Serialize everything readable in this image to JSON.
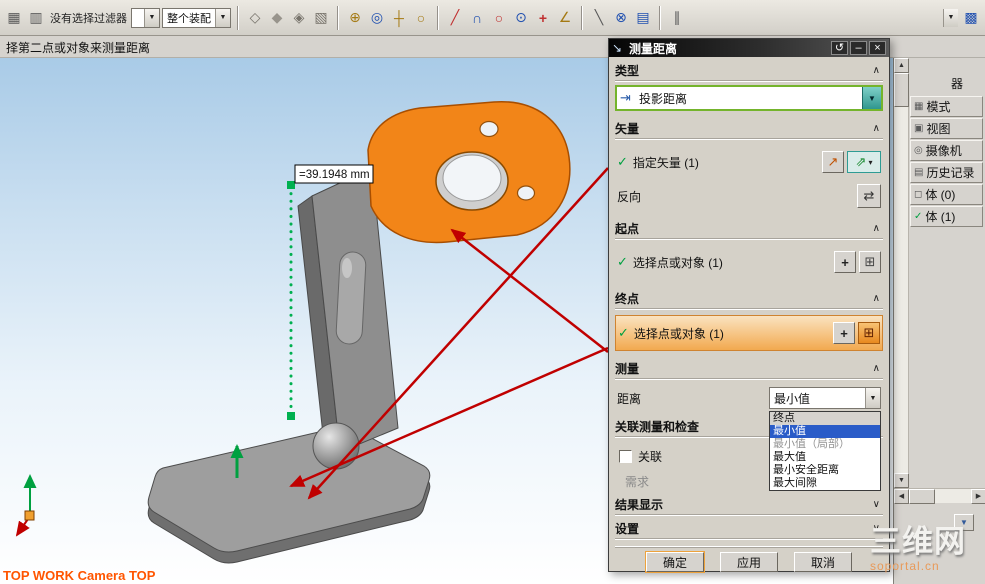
{
  "glyphs": {
    "up": "▲",
    "down": "▼",
    "left": "◀",
    "right": "▶",
    "chevron_up": "∧",
    "chevron_down": "∨",
    "check": "✓",
    "dropdown": "▾"
  },
  "toolbar": {
    "filter_combo_value": "没有选择过滤器",
    "type_combo_value": "",
    "scope_combo_value": "整个装配",
    "icons": [
      {
        "name": "selection-grid-icon",
        "glyph": "▦"
      },
      {
        "name": "filter-list-icon",
        "glyph": "▥"
      },
      {
        "name": "view-orient-icon",
        "glyph": "◇"
      },
      {
        "name": "shaded-view-icon",
        "glyph": "◆"
      },
      {
        "name": "wireframe-view-icon",
        "glyph": "◈"
      },
      {
        "name": "section-view-icon",
        "glyph": "▧"
      },
      {
        "name": "snap-point-icon",
        "glyph": "⊕"
      },
      {
        "name": "snap-center-icon",
        "glyph": "◎"
      },
      {
        "name": "snap-intersection-icon",
        "glyph": "┼"
      },
      {
        "name": "snap-quadrant-icon",
        "glyph": "○"
      },
      {
        "name": "line-tool-icon",
        "glyph": "╱"
      },
      {
        "name": "arc-tool-icon",
        "glyph": "∩"
      },
      {
        "name": "circle-tool-icon",
        "glyph": "○"
      },
      {
        "name": "point-tool-icon",
        "glyph": "⊙"
      },
      {
        "name": "plus-tool-icon",
        "glyph": "+"
      },
      {
        "name": "angle-tool-icon",
        "glyph": "∠"
      },
      {
        "name": "slash-tool-icon",
        "glyph": "╲"
      },
      {
        "name": "wcs-icon",
        "glyph": "⊗"
      },
      {
        "name": "datum-plane-icon",
        "glyph": "▤"
      },
      {
        "name": "measure-tool-icon",
        "glyph": "∥"
      },
      {
        "name": "nav-cube-icon",
        "glyph": "▩"
      }
    ]
  },
  "prompt": "择第二点或对象来测量距离",
  "dialog": {
    "title": "测量距离",
    "title_icon": "↘",
    "reset_icon": "↺",
    "minimize_icon": "–",
    "close_icon": "×",
    "sections": {
      "type": {
        "header": "类型",
        "combo_value": "投影距离",
        "combo_icon": "⇥"
      },
      "vector": {
        "header": "矢量",
        "specify_label": "指定矢量 (1)",
        "specify_icon": "↗",
        "vector_list_icon": "⇗",
        "reverse_label": "反向",
        "reverse_icon": "⇄"
      },
      "start": {
        "header": "起点",
        "select_label": "选择点或对象 (1)",
        "snap_icon": "+",
        "point_dialog_icon": "⊞"
      },
      "end": {
        "header": "终点",
        "select_label": "选择点或对象 (1)",
        "snap_icon": "+",
        "point_dialog_icon": "⊞"
      },
      "measure": {
        "header": "测量",
        "distance_label": "距离",
        "distance_value": "最小值"
      },
      "assoc": {
        "header": "关联测量和检查",
        "checkbox_label": "关联",
        "requirement_label": "需求"
      },
      "results": {
        "header": "结果显示"
      },
      "settings": {
        "header": "设置"
      }
    },
    "dropdown_options": [
      {
        "label": "终点"
      },
      {
        "label": "最小值"
      },
      {
        "label": "最小值（局部）"
      },
      {
        "label": "最大值"
      },
      {
        "label": "最小安全距离"
      },
      {
        "label": "最大间隙"
      }
    ],
    "buttons": {
      "ok": "确定",
      "apply": "应用",
      "cancel": "取消"
    }
  },
  "viewport": {
    "dimension_label": "=39.1948 mm",
    "camera_label": "TOP WORK Camera TOP"
  },
  "right_panel": {
    "header_fragment": "器",
    "rows": [
      {
        "icon": "▦",
        "label": "模式"
      },
      {
        "icon": "▣",
        "label": "视图"
      },
      {
        "icon": "◎",
        "label": "摄像机"
      },
      {
        "icon": "▤",
        "label": "历史记录"
      },
      {
        "icon": "◻",
        "label": "体 (0)"
      },
      {
        "icon": "✓",
        "label": "体 (1)"
      }
    ]
  },
  "watermark": {
    "line1": "三维网",
    "line2": "soportal.cn"
  },
  "colors": {
    "accent_orange": "#f28518",
    "selection_blue": "#2a5cc8",
    "check_green": "#00a040",
    "arrow_red": "#c00000"
  }
}
